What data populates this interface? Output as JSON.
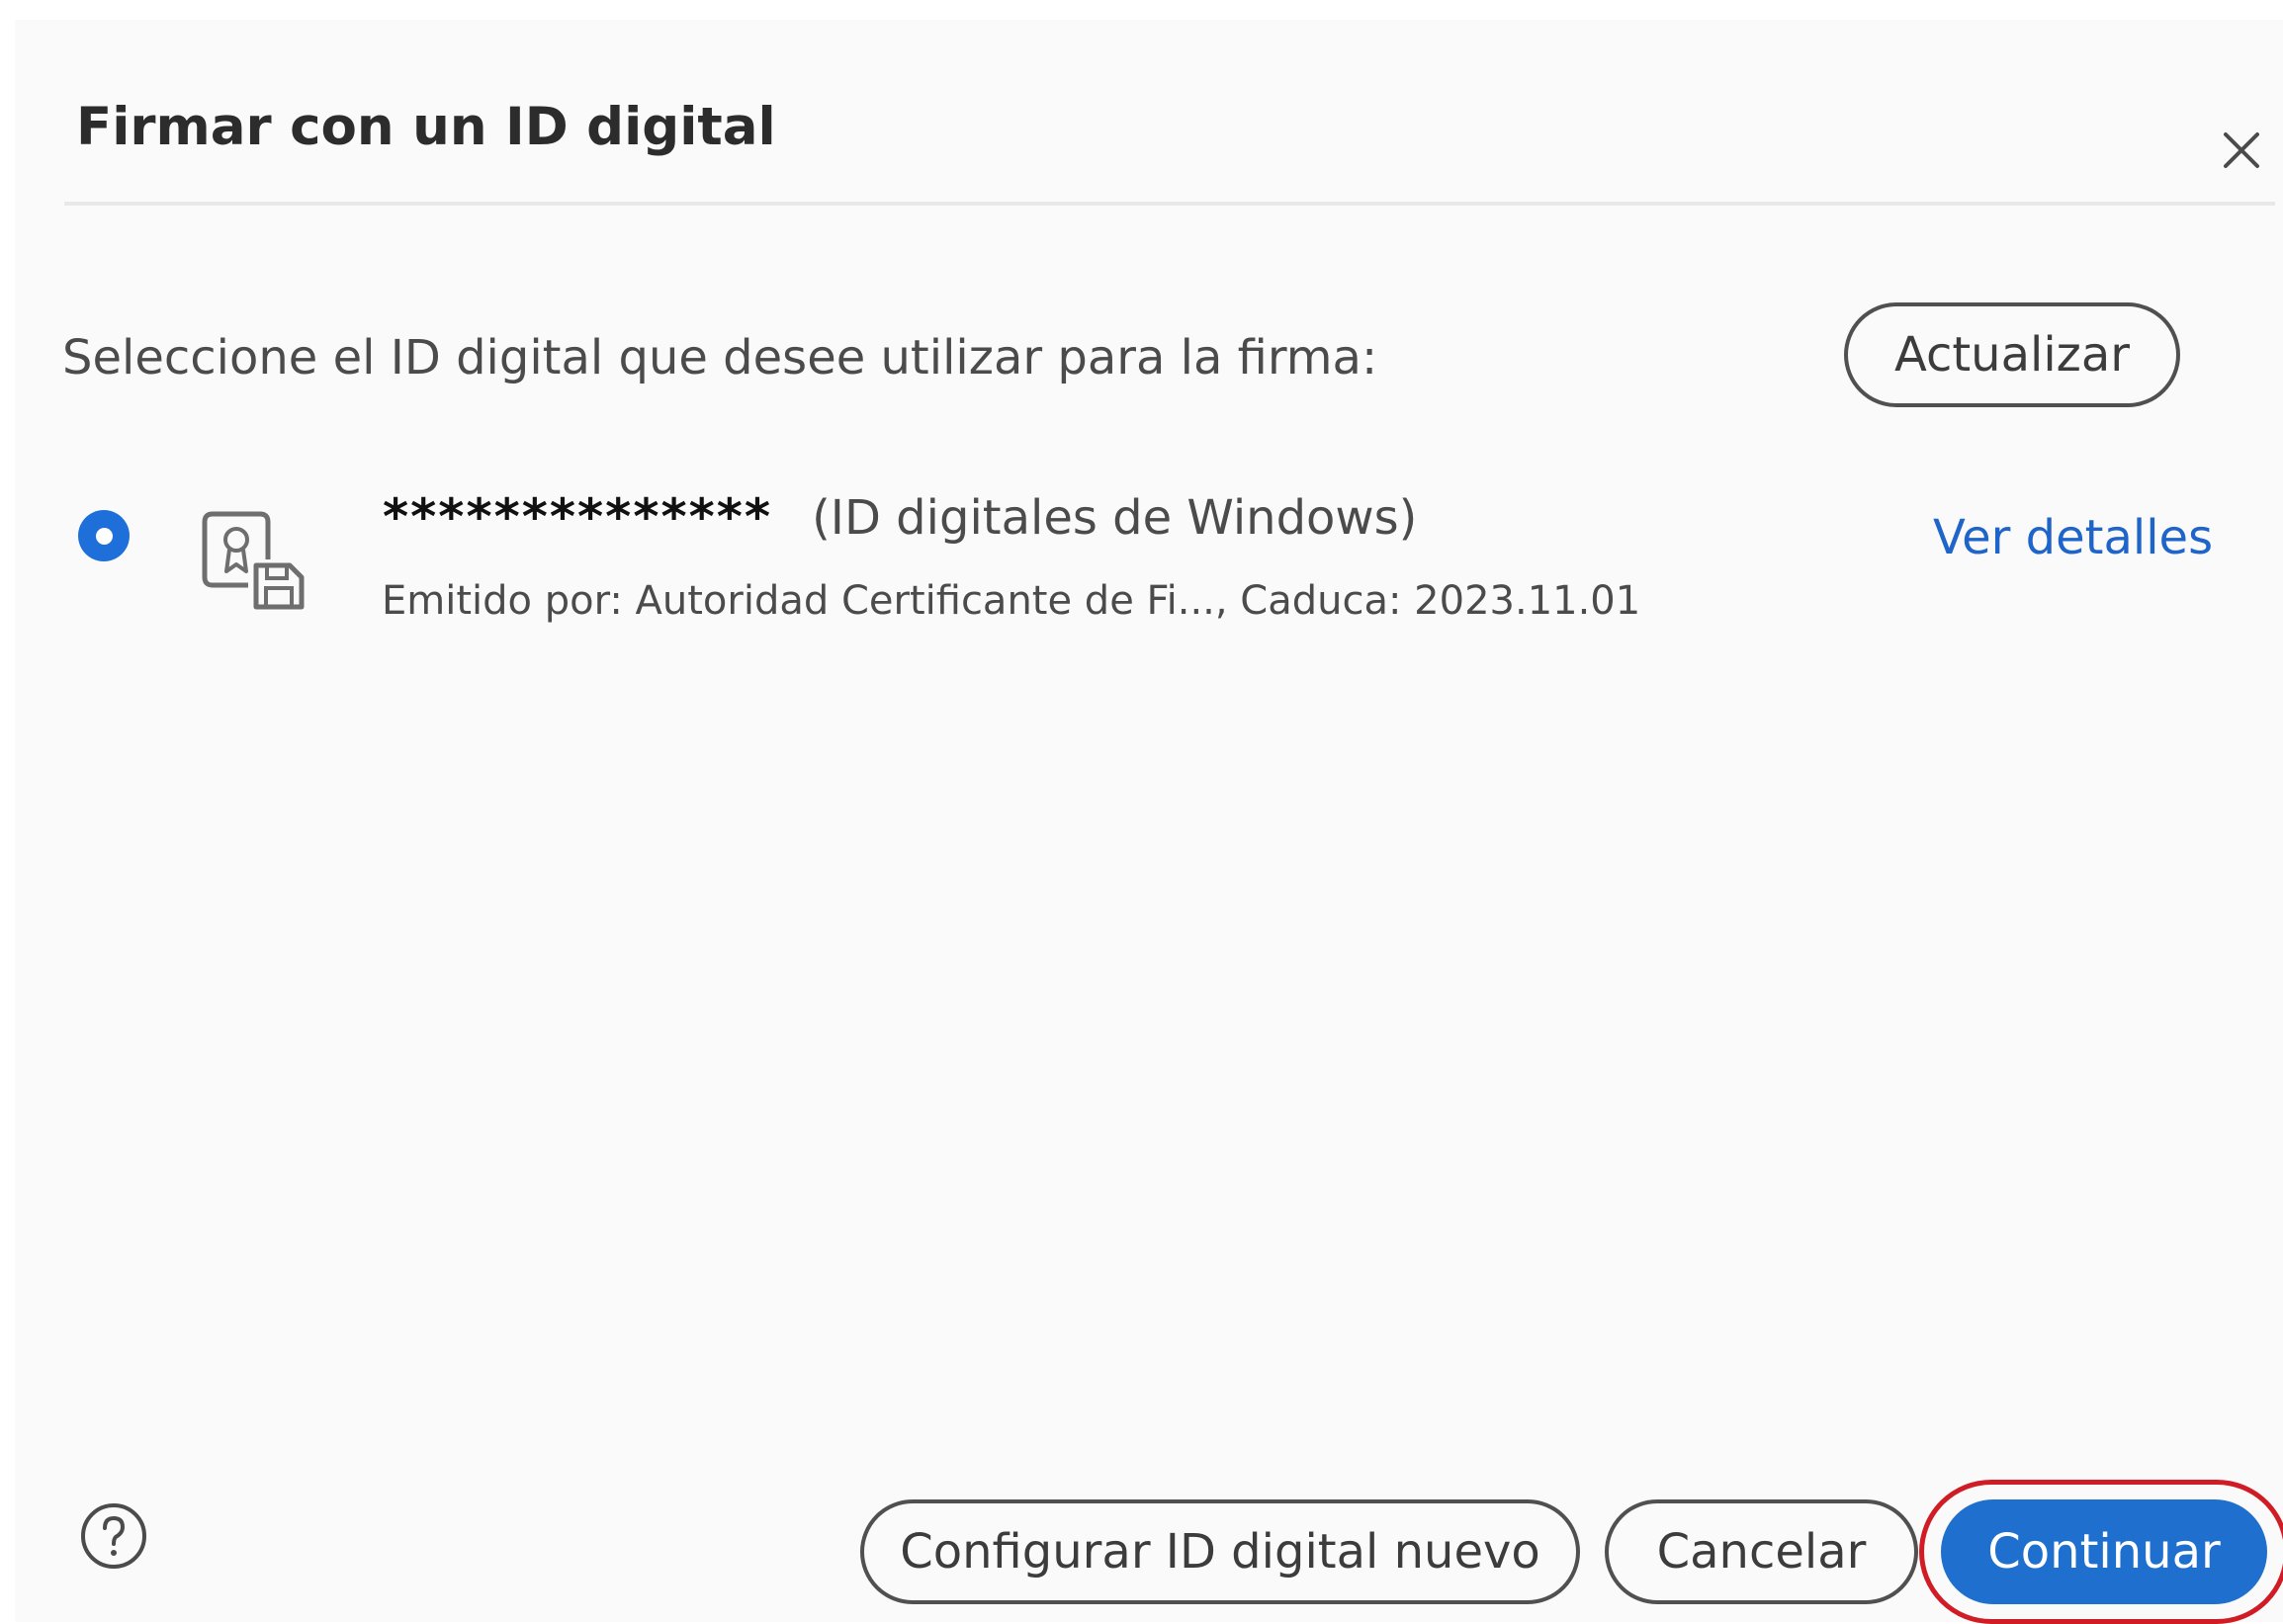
{
  "dialog": {
    "title": "Firmar con un ID digital",
    "close_icon": "close-icon"
  },
  "instruction": "Seleccione el ID digital que desee utilizar para la firma:",
  "update_button": "Actualizar",
  "digital_ids": [
    {
      "selected": true,
      "icon": "certificate-icon",
      "name": "**************",
      "type": "(ID digitales de Windows)",
      "issuer_line": "Emitido por: Autoridad Certificante de Fi..., Caduca: 2023.11.01",
      "details_link": "Ver detalles"
    }
  ],
  "footer": {
    "help_icon": "help-icon",
    "new_id_button": "Configurar ID digital nuevo",
    "cancel_button": "Cancelar",
    "continue_button": "Continuar"
  },
  "colors": {
    "accent": "#1f6fcf",
    "link": "#1f64c8",
    "highlight": "#d01c24"
  }
}
